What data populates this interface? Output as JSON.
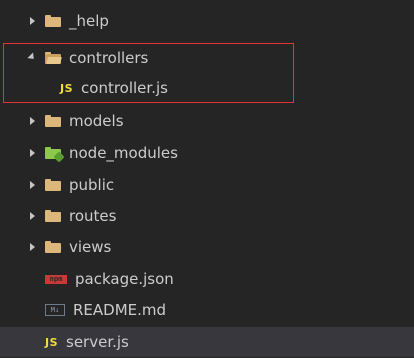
{
  "explorer": {
    "items": [
      {
        "label": "_help",
        "icon": "folder-icon"
      },
      {
        "label": "controllers",
        "icon": "folder-open-icon"
      },
      {
        "label": "controller.js",
        "icon": "js-icon",
        "badge": "JS"
      },
      {
        "label": "models",
        "icon": "folder-icon"
      },
      {
        "label": "node_modules",
        "icon": "node-folder-icon"
      },
      {
        "label": "public",
        "icon": "folder-icon"
      },
      {
        "label": "routes",
        "icon": "folder-icon"
      },
      {
        "label": "views",
        "icon": "folder-icon"
      },
      {
        "label": "package.json",
        "icon": "npm-icon",
        "badge": "npm"
      },
      {
        "label": "README.md",
        "icon": "markdown-icon",
        "badge": "M↓"
      },
      {
        "label": "server.js",
        "icon": "js-icon",
        "badge": "JS"
      }
    ]
  },
  "colors": {
    "background": "#252526",
    "selected_row": "#37373d",
    "folder": "#dcb67a",
    "js": "#f1dd35",
    "npm": "#cb3837",
    "highlight_border": "#e13434"
  }
}
